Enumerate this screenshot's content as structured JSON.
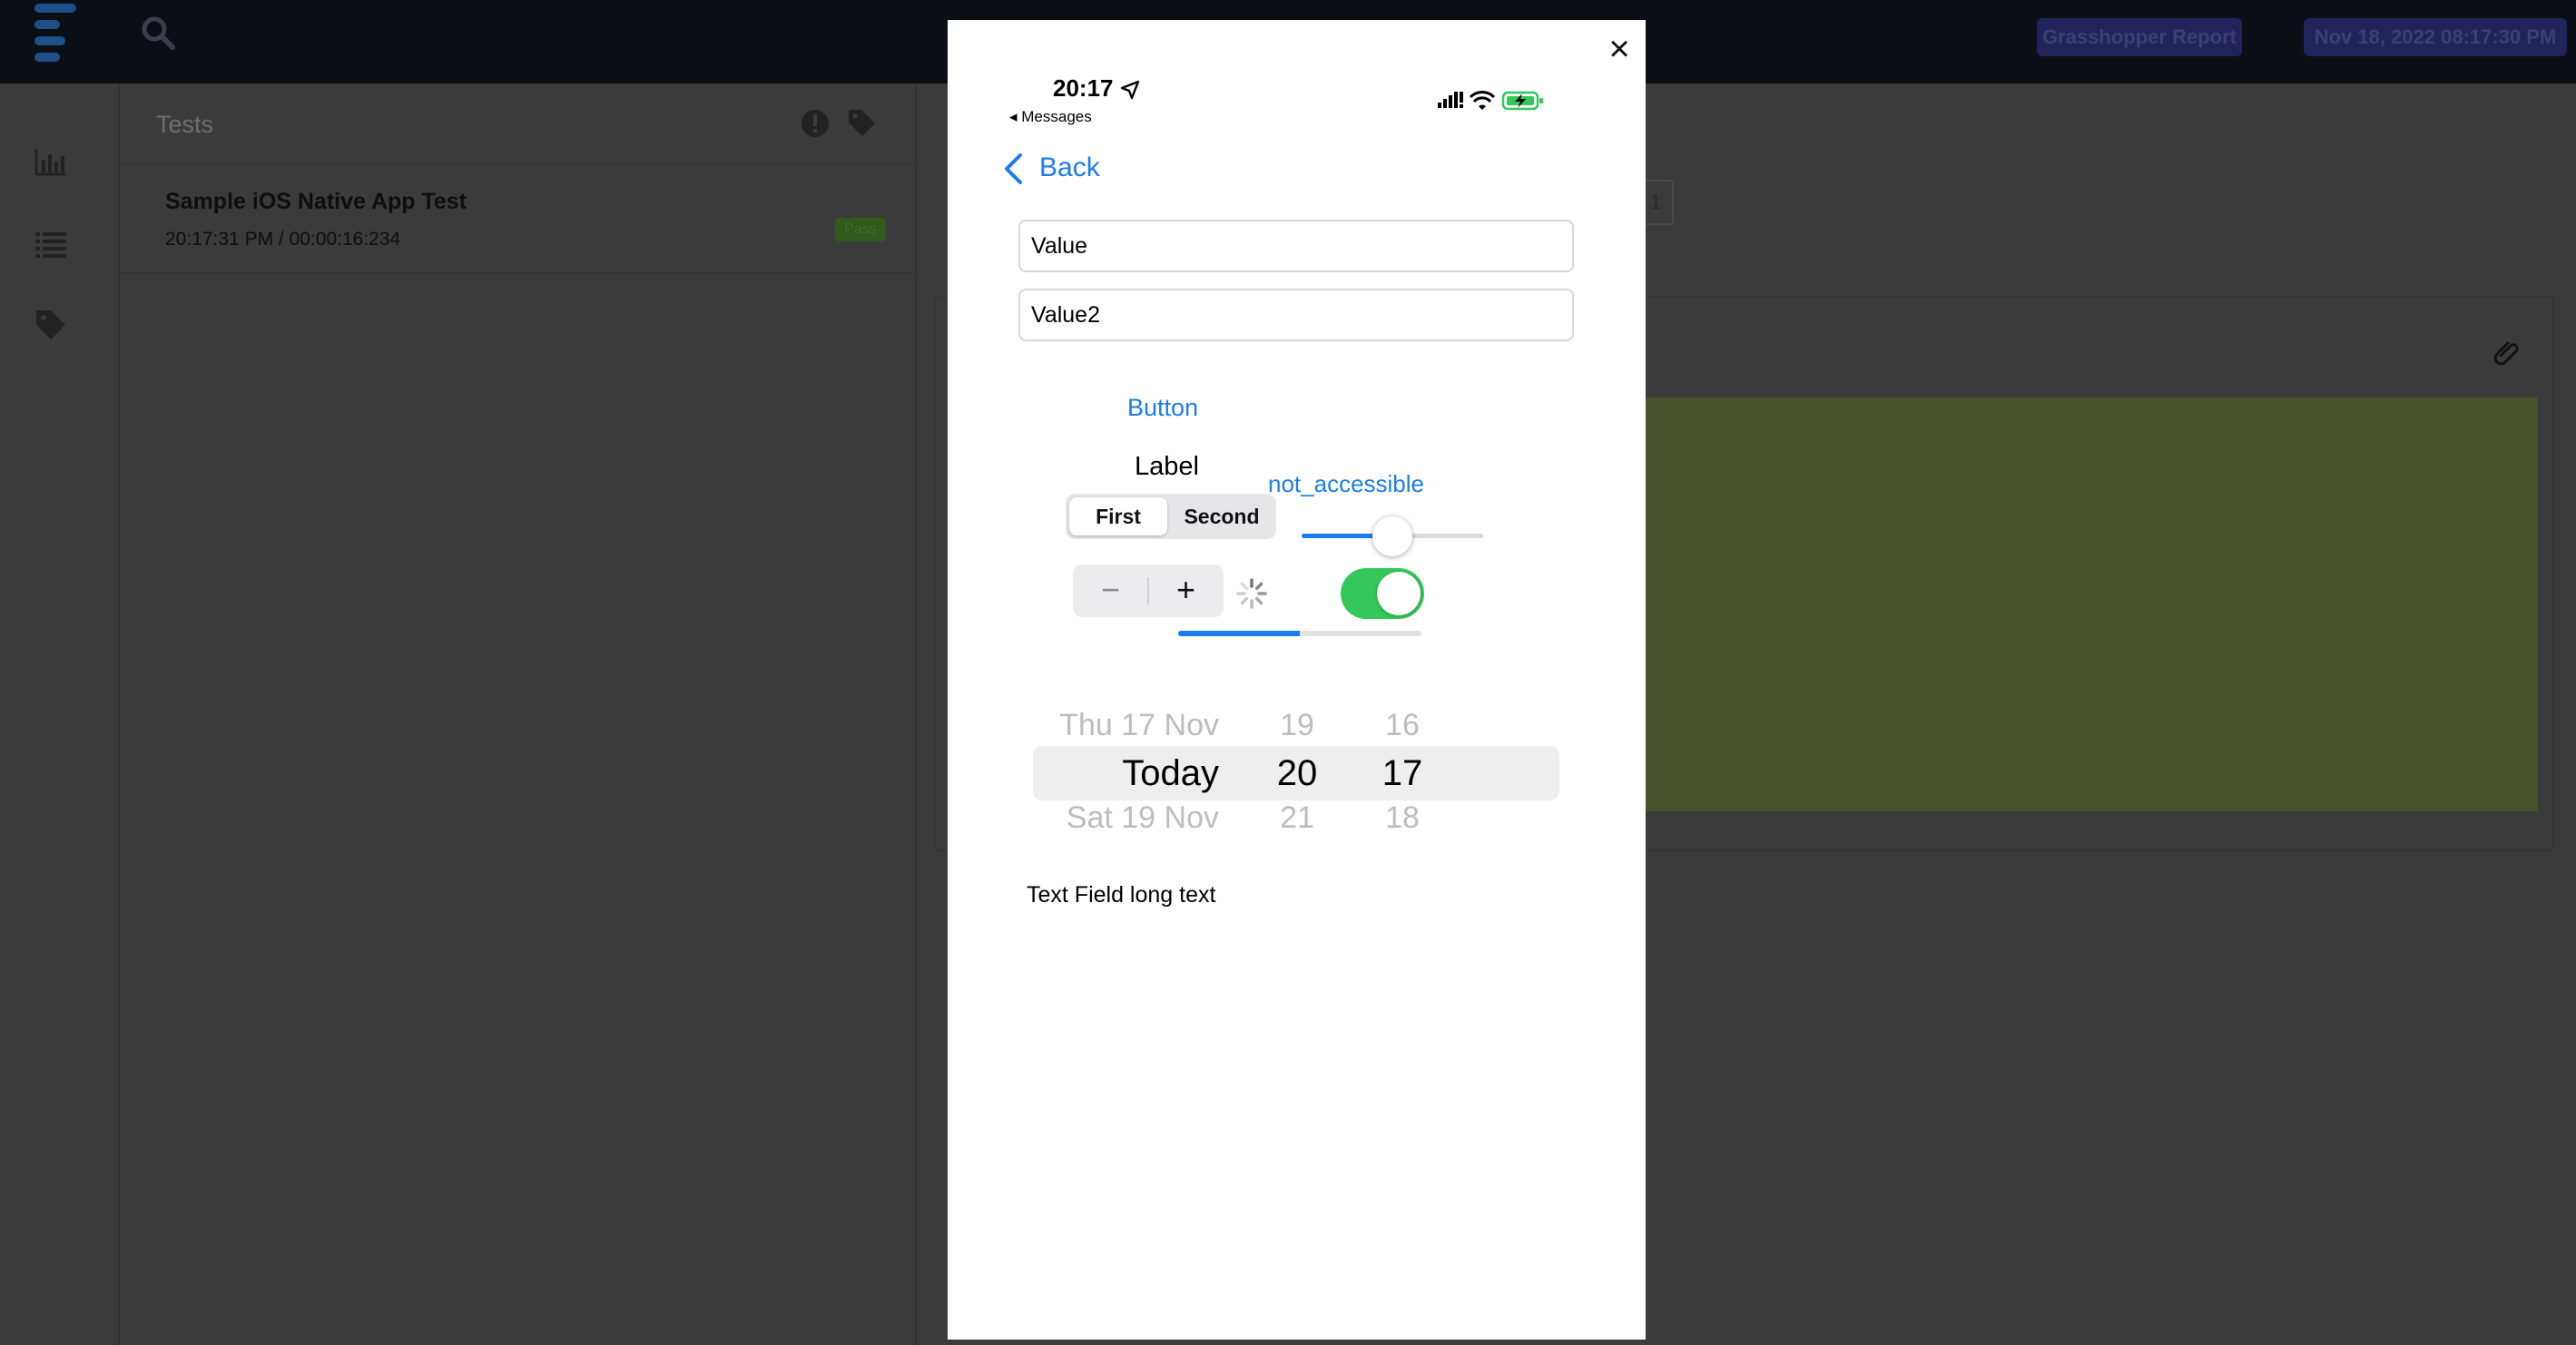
{
  "header": {
    "report_label": "Grasshopper Report",
    "datetime": "Nov 18, 2022 08:17:30 PM"
  },
  "tests_panel": {
    "title": "Tests",
    "items": [
      {
        "name": "Sample iOS Native App Test",
        "time": "20:17:31 PM / 00:00:16:234",
        "status": "Pass"
      }
    ]
  },
  "main": {
    "tag_count": "1"
  },
  "modal": {
    "close_symbol": "×"
  },
  "phone": {
    "status_bar": {
      "time": "20:17",
      "back_app": "◂ Messages",
      "battery_level": 1.0
    },
    "nav": {
      "back_label": "Back"
    },
    "text_field_1": {
      "value": "Value"
    },
    "text_field_2": {
      "value": "Value2"
    },
    "button_label": "Button",
    "label_text": "Label",
    "not_accessible_label": "not_accessible",
    "segmented": {
      "items": [
        "First",
        "Second"
      ],
      "selected": "First"
    },
    "slider": {
      "value": 0.5
    },
    "stepper": {
      "minus": "−",
      "plus": "+"
    },
    "switch": {
      "on": true
    },
    "progress": {
      "value": 0.5
    },
    "picker": {
      "dates": [
        "Thu 17 Nov",
        "Today",
        "Sat 19 Nov"
      ],
      "hours": [
        "19",
        "20",
        "21"
      ],
      "minutes": [
        "16",
        "17",
        "18"
      ],
      "selected_index": 1
    },
    "long_text": "Text Field long text"
  },
  "colors": {
    "ios_blue": "#1a7cf0",
    "switch_green": "#34c759",
    "topbar": "#0b0e15",
    "overlay": "#3b3b3b"
  }
}
